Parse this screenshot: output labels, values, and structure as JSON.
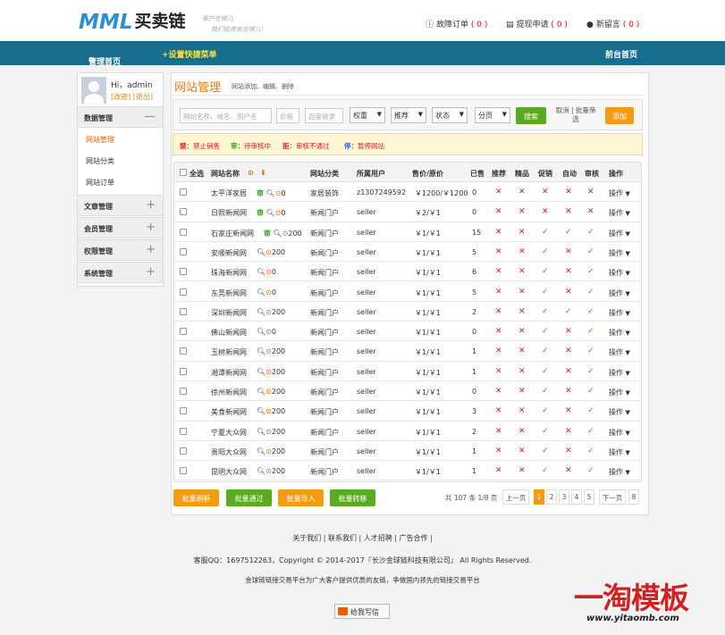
{
  "header": {
    "logo_mark": "MML",
    "logo_text": "买卖链",
    "slogan_line1": "客户在哪儿",
    "slogan_line2": "我们链接就在哪儿!",
    "links": [
      {
        "label": "故障订单",
        "count": "( 0 )"
      },
      {
        "label": "提现申请",
        "count": "( 0 )"
      },
      {
        "label": "新留言",
        "count": "( 0 )"
      }
    ]
  },
  "nav": {
    "home": "管理首页",
    "quick": "+设置快捷菜单",
    "frontend": "前台首页"
  },
  "sidebar": {
    "greeting": "Hi，admin",
    "modify": "[改密]",
    "logout": "[退出]",
    "groups": [
      {
        "label": "数据管理",
        "symbol": "—",
        "items": [
          "网站管理",
          "网站分类",
          "网站订单"
        ]
      },
      {
        "label": "文章管理",
        "symbol": "+"
      },
      {
        "label": "会员管理",
        "symbol": "+"
      },
      {
        "label": "权限管理",
        "symbol": "+"
      },
      {
        "label": "系统管理",
        "symbol": "+"
      }
    ]
  },
  "main": {
    "title": "网站管理",
    "subtitle": "网站添加、编辑、删除",
    "filters": {
      "keyword_placeholder": "网站名称、域名、用户名",
      "price_placeholder": "价格",
      "baidu_placeholder": "百度收录",
      "selects": [
        "权重",
        "推荐",
        "状态",
        "分页"
      ],
      "search": "搜索",
      "cancel": "取消 | 批量筛选",
      "add": "添加"
    },
    "legend": [
      {
        "code": "禁",
        "text": "禁止销售",
        "color": "#d42020"
      },
      {
        "code": "审",
        "text": "待审核中",
        "color": "#3aa021"
      },
      {
        "code": "拒",
        "text": "审核不通过",
        "color": "#d42020"
      },
      {
        "code": "停",
        "text": "暂停网站",
        "color": "#3366cc"
      }
    ],
    "columns": [
      "全选",
      "网站名称",
      "网站分类",
      "所属用户",
      "售价/原价",
      "已售",
      "推荐",
      "精品",
      "促销",
      "自动",
      "审核",
      "操作"
    ],
    "rows": [
      {
        "name": "太平洋家居",
        "shen": true,
        "num": "0",
        "cat": "家居装饰",
        "user": "z1307249592",
        "price": "￥1200/￥1200",
        "sold": "0",
        "flags": [
          "x",
          "x",
          "x",
          "x",
          "x"
        ]
      },
      {
        "name": "日照新闻网",
        "shen": true,
        "num": "0",
        "cat": "新闻门户",
        "user": "seller",
        "price": "￥2/￥1",
        "sold": "0",
        "flags": [
          "x",
          "x",
          "x",
          "x",
          "x"
        ]
      },
      {
        "name": "石家庄新闻网",
        "shen": true,
        "num": "200",
        "cat": "新闻门户",
        "user": "seller",
        "price": "￥1/￥1",
        "sold": "15",
        "flags": [
          "x",
          "x",
          "v",
          "v",
          "v"
        ]
      },
      {
        "name": "安顺新闻网",
        "shen": false,
        "num": "200",
        "cat": "新闻门户",
        "user": "seller",
        "price": "￥1/￥1",
        "sold": "5",
        "flags": [
          "x",
          "x",
          "v",
          "x",
          "v"
        ]
      },
      {
        "name": "珠海新闻网",
        "shen": false,
        "num": "0",
        "cat": "新闻门户",
        "user": "seller",
        "price": "￥1/￥1",
        "sold": "6",
        "flags": [
          "x",
          "x",
          "v",
          "x",
          "v"
        ]
      },
      {
        "name": "东莞新闻网",
        "shen": false,
        "num": "0",
        "cat": "新闻门户",
        "user": "seller",
        "price": "￥1/￥1",
        "sold": "5",
        "flags": [
          "x",
          "x",
          "v",
          "x",
          "v"
        ]
      },
      {
        "name": "深圳新闻网",
        "shen": false,
        "num": "200",
        "cat": "新闻门户",
        "user": "seller",
        "price": "￥1/￥1",
        "sold": "2",
        "flags": [
          "x",
          "x",
          "v",
          "v",
          "v"
        ]
      },
      {
        "name": "佛山新闻网",
        "shen": false,
        "num": "0",
        "cat": "新闻门户",
        "user": "seller",
        "price": "￥1/￥1",
        "sold": "0",
        "flags": [
          "x",
          "x",
          "v",
          "x",
          "v"
        ]
      },
      {
        "name": "玉树新闻网",
        "shen": false,
        "num": "200",
        "cat": "新闻门户",
        "user": "seller",
        "price": "￥1/￥1",
        "sold": "1",
        "flags": [
          "x",
          "x",
          "v",
          "x",
          "v"
        ]
      },
      {
        "name": "湘潭新闻网",
        "shen": false,
        "num": "200",
        "cat": "新闻门户",
        "user": "seller",
        "price": "￥1/￥1",
        "sold": "1",
        "flags": [
          "x",
          "x",
          "v",
          "x",
          "v"
        ]
      },
      {
        "name": "徐州新闻网",
        "shen": false,
        "num": "200",
        "cat": "新闻门户",
        "user": "seller",
        "price": "￥1/￥1",
        "sold": "0",
        "flags": [
          "x",
          "x",
          "v",
          "x",
          "v"
        ]
      },
      {
        "name": "美食新闻网",
        "shen": false,
        "num": "200",
        "cat": "新闻门户",
        "user": "seller",
        "price": "￥1/￥1",
        "sold": "3",
        "flags": [
          "x",
          "x",
          "v",
          "x",
          "v"
        ]
      },
      {
        "name": "宁夏大众网",
        "shen": false,
        "num": "200",
        "cat": "新闻门户",
        "user": "seller",
        "price": "￥1/￥1",
        "sold": "2",
        "flags": [
          "x",
          "x",
          "v",
          "x",
          "v"
        ]
      },
      {
        "name": "贵阳大众网",
        "shen": false,
        "num": "200",
        "cat": "新闻门户",
        "user": "seller",
        "price": "￥1/￥1",
        "sold": "1",
        "flags": [
          "x",
          "x",
          "v",
          "x",
          "v"
        ]
      },
      {
        "name": "昆明大众网",
        "shen": false,
        "num": "200",
        "cat": "新闻门户",
        "user": "seller",
        "price": "￥1/￥1",
        "sold": "1",
        "flags": [
          "x",
          "x",
          "v",
          "x",
          "v"
        ]
      }
    ],
    "row_action": "操作",
    "batch_buttons": [
      "批量刷新",
      "批量通过",
      "批量导入",
      "批量转移"
    ],
    "pager": {
      "summary": "共 107 条 1/8 页",
      "prev": "上一页",
      "pages": [
        "1",
        "2",
        "3",
        "4",
        "5"
      ],
      "next": "下一页",
      "last": "8"
    }
  },
  "footer": {
    "links": "关于我们 | 联系我们 | 人才招聘 | 广告合作 |",
    "copyright": "客服QQ：1697512263，Copyright © 2014-2017『长沙金球链科技有限公司』 All Rights Reserved.",
    "desc": "金球链链接交易平台为广大客户提供优质的友链，争做国内领先的链接交易平台",
    "message": "给我写信"
  },
  "watermark": {
    "main": "一淘模板",
    "url": "www.yitaomb.com"
  },
  "colors": {
    "nav": "#166e8c",
    "accent": "#e67e22",
    "green": "#5aab1f",
    "orange": "#f39c12",
    "cross": "#d42020",
    "check": "#3aa021"
  }
}
